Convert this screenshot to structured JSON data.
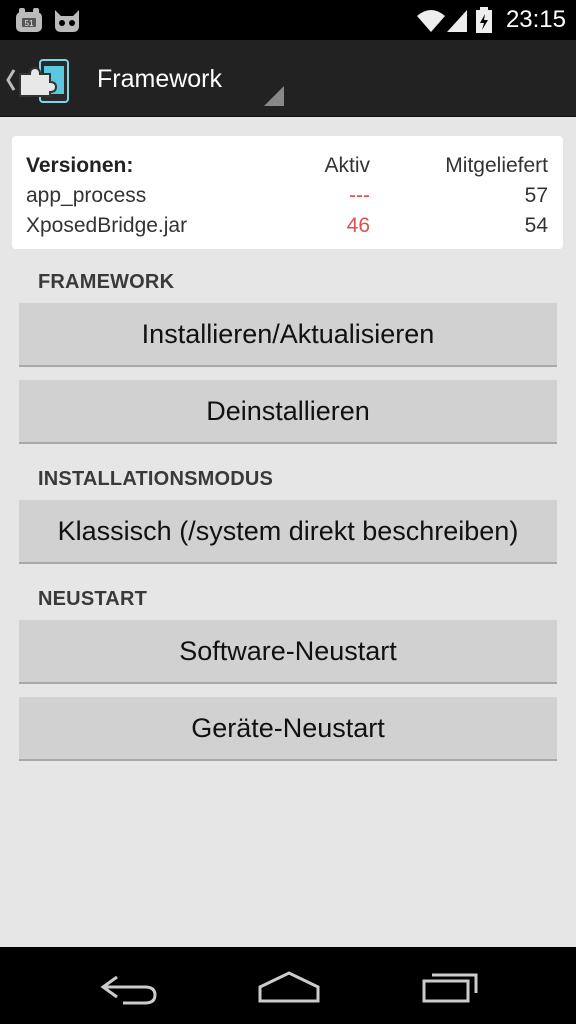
{
  "status_bar": {
    "time": "23:15",
    "notification_icons": [
      "cyanogenmod-notification-icon",
      "android-cat-icon"
    ],
    "system_icons": [
      "wifi-icon",
      "signal-icon",
      "battery-icon"
    ]
  },
  "action_bar": {
    "title": "Framework",
    "app_icon": "xposed-puzzle-icon"
  },
  "versions": {
    "header": {
      "label": "Versionen:",
      "active": "Aktiv",
      "bundled": "Mitgeliefert"
    },
    "rows": [
      {
        "name": "app_process",
        "active": "---",
        "bundled": "57"
      },
      {
        "name": "XposedBridge.jar",
        "active": "46",
        "bundled": "54"
      }
    ],
    "mismatch_color": "#d9534f"
  },
  "sections": {
    "framework": {
      "title": "FRAMEWORK",
      "buttons": [
        "Installieren/Aktualisieren",
        "Deinstallieren"
      ]
    },
    "install_mode": {
      "title": "INSTALLATIONSMODUS",
      "selected": "Klassisch (/system direkt beschreiben)"
    },
    "reboot": {
      "title": "NEUSTART",
      "buttons": [
        "Software-Neustart",
        "Geräte-Neustart"
      ]
    }
  },
  "nav_bar": {
    "icons": [
      "back-icon",
      "home-icon",
      "recents-icon"
    ]
  }
}
